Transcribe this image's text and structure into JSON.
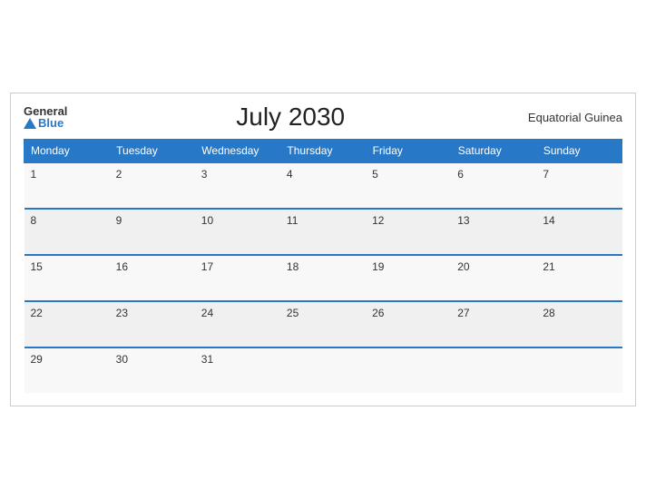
{
  "header": {
    "logo_general": "General",
    "logo_blue": "Blue",
    "title": "July 2030",
    "country": "Equatorial Guinea"
  },
  "weekdays": [
    "Monday",
    "Tuesday",
    "Wednesday",
    "Thursday",
    "Friday",
    "Saturday",
    "Sunday"
  ],
  "weeks": [
    [
      {
        "day": "1"
      },
      {
        "day": "2"
      },
      {
        "day": "3"
      },
      {
        "day": "4"
      },
      {
        "day": "5"
      },
      {
        "day": "6"
      },
      {
        "day": "7"
      }
    ],
    [
      {
        "day": "8"
      },
      {
        "day": "9"
      },
      {
        "day": "10"
      },
      {
        "day": "11"
      },
      {
        "day": "12"
      },
      {
        "day": "13"
      },
      {
        "day": "14"
      }
    ],
    [
      {
        "day": "15"
      },
      {
        "day": "16"
      },
      {
        "day": "17"
      },
      {
        "day": "18"
      },
      {
        "day": "19"
      },
      {
        "day": "20"
      },
      {
        "day": "21"
      }
    ],
    [
      {
        "day": "22"
      },
      {
        "day": "23"
      },
      {
        "day": "24"
      },
      {
        "day": "25"
      },
      {
        "day": "26"
      },
      {
        "day": "27"
      },
      {
        "day": "28"
      }
    ],
    [
      {
        "day": "29"
      },
      {
        "day": "30"
      },
      {
        "day": "31"
      },
      {
        "day": ""
      },
      {
        "day": ""
      },
      {
        "day": ""
      },
      {
        "day": ""
      }
    ]
  ]
}
